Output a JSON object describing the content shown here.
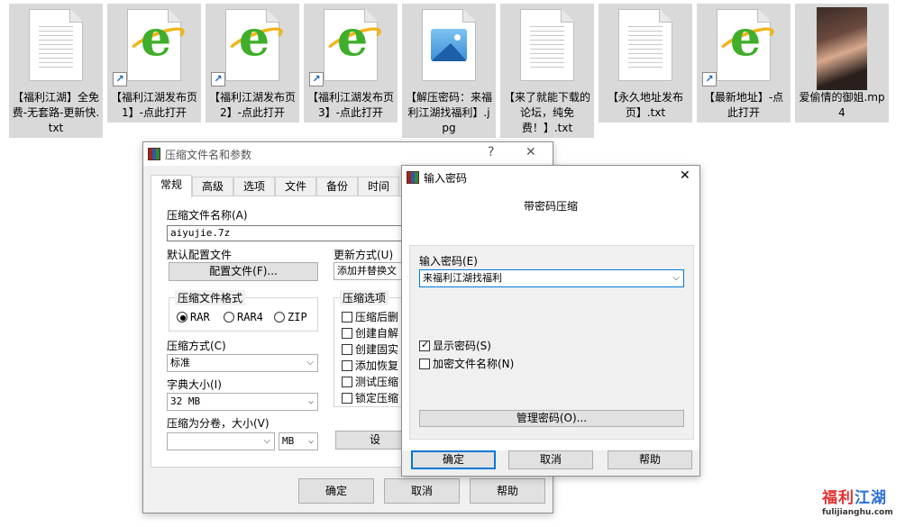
{
  "desktop": {
    "files": [
      {
        "name": "【福利江湖】全免费-无套路-更新快.txt",
        "icon": "text-file-icon"
      },
      {
        "name": "【福利江湖发布页1】-点此打开",
        "icon": "ie-shortcut-icon"
      },
      {
        "name": "【福利江湖发布页2】-点此打开",
        "icon": "ie-shortcut-icon"
      },
      {
        "name": "【福利江湖发布页3】-点此打开",
        "icon": "ie-shortcut-icon"
      },
      {
        "name": "【解压密码：来福利江湖找福利】.jpg",
        "icon": "image-file-icon"
      },
      {
        "name": "【来了就能下载的论坛，纯免费！】.txt",
        "icon": "text-file-icon"
      },
      {
        "name": "【永久地址发布页】.txt",
        "icon": "text-file-icon"
      },
      {
        "name": "【最新地址】-点此打开",
        "icon": "ie-shortcut-icon"
      },
      {
        "name": "爱偷情的御姐.mp4",
        "icon": "video-thumbnail"
      }
    ]
  },
  "archive_dialog": {
    "title": "压缩文件名和参数",
    "help_glyph": "?",
    "close_glyph": "✕",
    "tabs": [
      "常规",
      "高级",
      "选项",
      "文件",
      "备份",
      "时间"
    ],
    "archive_name_label": "压缩文件名称(A)",
    "archive_name_value": "aiyujie.7z",
    "default_profile_label": "默认配置文件",
    "profiles_button": "配置文件(F)...",
    "update_mode_label": "更新方式(U)",
    "update_mode_value": "添加并替换文",
    "format_group": "压缩文件格式",
    "formats": [
      "RAR",
      "RAR4",
      "ZIP"
    ],
    "method_label": "压缩方式(C)",
    "method_value": "标准",
    "dict_label": "字典大小(I)",
    "dict_value": "32 MB",
    "split_label": "压缩为分卷，大小(V)",
    "split_value": "",
    "split_unit": "MB",
    "options_group": "压缩选项",
    "options": [
      "压缩后删",
      "创建自解",
      "创建固实",
      "添加恢复",
      "测试压缩",
      "锁定压缩"
    ],
    "set_password_button": "设",
    "ok": "确定",
    "cancel": "取消",
    "help": "帮助"
  },
  "password_dialog": {
    "title": "输入密码",
    "close_glyph": "✕",
    "heading": "带密码压缩",
    "password_label": "输入密码(E)",
    "password_value": "来福利江湖找福利",
    "show_password": "显示密码(S)",
    "show_password_checked": true,
    "encrypt_names": "加密文件名称(N)",
    "encrypt_names_checked": false,
    "manage_button": "管理密码(O)...",
    "ok": "确定",
    "cancel": "取消",
    "help": "帮助"
  },
  "watermark": {
    "title_a": "福利",
    "title_b": "江湖",
    "url": "fulijianghu.com"
  },
  "colors": {
    "accent": "#0078d7",
    "tile_bg": "#d9d9d9",
    "ie_green": "#3fae2a"
  }
}
